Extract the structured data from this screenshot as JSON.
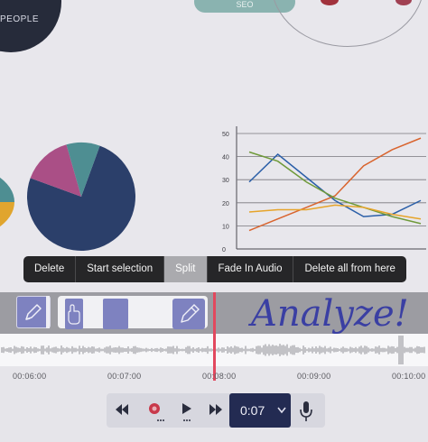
{
  "canvas": {
    "people_label": "PEOPLE",
    "seo_label": "SEO",
    "line_chart_ticks": [
      "50",
      "40",
      "30",
      "20",
      "10",
      "0"
    ],
    "handwriting_text": "Analyze!"
  },
  "chart_data": {
    "type": "line",
    "x": [
      1,
      2,
      3,
      4,
      5,
      6,
      7
    ],
    "ylim": [
      0,
      50
    ],
    "yticks": [
      0,
      10,
      20,
      30,
      40,
      50
    ],
    "grid": true,
    "series": [
      {
        "color": "#2b5fa8",
        "values": [
          29,
          41,
          31,
          21,
          14,
          15,
          21
        ]
      },
      {
        "color": "#d9642e",
        "values": [
          8,
          13,
          18,
          23,
          36,
          43,
          48
        ]
      },
      {
        "color": "#6f9a3a",
        "values": [
          42,
          38,
          29,
          22,
          18,
          14,
          11
        ]
      },
      {
        "color": "#e6a42a",
        "values": [
          16,
          17,
          17,
          19,
          18,
          15,
          13
        ]
      }
    ]
  },
  "pie_data": {
    "type": "pie",
    "slices": [
      {
        "value": 75,
        "color": "#2b3f6a"
      },
      {
        "value": 15,
        "color": "#aa4f86"
      },
      {
        "value": 10,
        "color": "#4e8e92"
      }
    ]
  },
  "context_menu": {
    "items": [
      {
        "label": "Delete",
        "active": false
      },
      {
        "label": "Start selection",
        "active": false
      },
      {
        "label": "Split",
        "active": true
      },
      {
        "label": "Fade In Audio",
        "active": false
      },
      {
        "label": "Delete all from here",
        "active": false
      }
    ]
  },
  "timeline": {
    "labels": [
      "00:06:00",
      "00:07:00",
      "00:08:00",
      "00:09:00",
      "00:10:00"
    ],
    "playhead_color": "#e2485e"
  },
  "toolbar": {
    "rewind_icon": "rewind-icon",
    "record_icon": "record-icon",
    "play_icon": "play-icon",
    "forward_icon": "fast-forward-icon",
    "time_value": "0:07",
    "mic_icon": "microphone-icon",
    "accent": "#232b52"
  }
}
